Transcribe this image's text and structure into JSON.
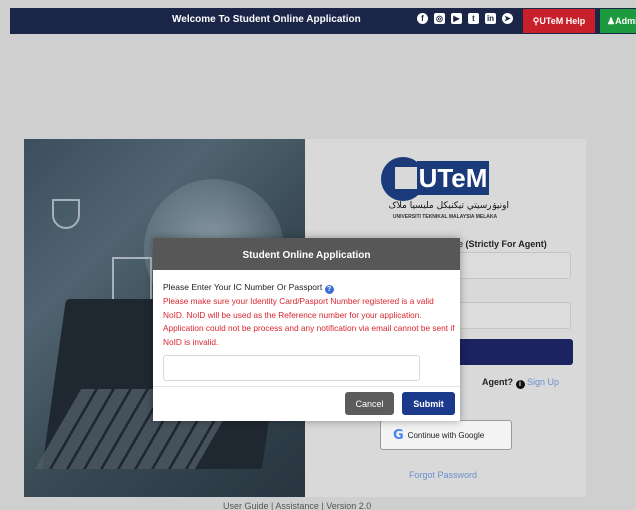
{
  "topbar": {
    "title": "Welcome To Student Online Application",
    "social_icons": [
      "facebook-icon",
      "instagram-icon",
      "youtube-icon",
      "twitter-icon",
      "linkedin-icon",
      "telegram-icon"
    ],
    "help_label": "UTeM Help",
    "admin_label": "Admin",
    "colors": {
      "bar": "#1a2547",
      "help": "#c8202a",
      "admin": "#1e9a3e"
    }
  },
  "logo": {
    "text": "UTeM",
    "arabic": "اونيۏرسيتي تيکنيکل مليسيا ملاک",
    "university": "UNIVERSITI TEKNIKAL MALAYSIA MELAKA"
  },
  "login": {
    "agent_code_label_prefix": "de",
    "agent_code_label": "(Strictly For Agent)",
    "agent_question": "Agent?",
    "sign_up_link": "Sign Up",
    "google_button": "Continue with Google",
    "forgot_password": "Forgot Password"
  },
  "footer": {
    "text": "User Guide | Assistance | Version 2.0"
  },
  "modal": {
    "title": "Student Online Application",
    "label": "Please Enter Your IC Number Or Passport",
    "warning": "Please make sure your Identity Card/Pasport Number registered is a valid NoID. NoID will be used as the Reference number for your application. Application could not be process and any notification via email cannot be sent if NoID is invalid.",
    "input_value": "",
    "cancel_label": "Cancel",
    "submit_label": "Submit",
    "colors": {
      "warning": "#d8262e",
      "submit": "#1b3a8c"
    }
  }
}
